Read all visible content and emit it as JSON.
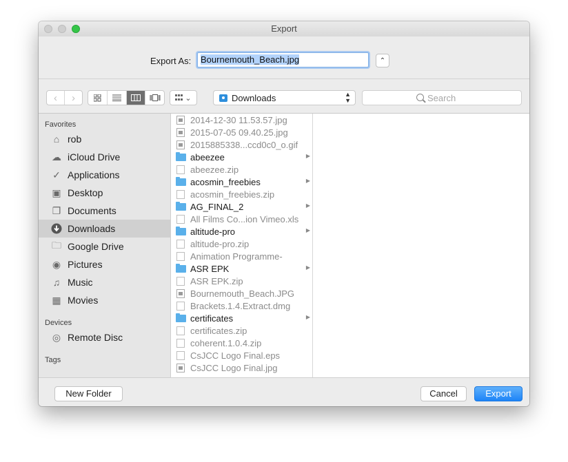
{
  "window": {
    "title": "Export"
  },
  "save": {
    "label": "Export As:",
    "filename": "Bournemouth_Beach.jpg"
  },
  "toolbar": {
    "location": "Downloads",
    "search_placeholder": "Search"
  },
  "sidebar": {
    "favorites_heading": "Favorites",
    "favorites": [
      {
        "label": "rob",
        "icon": "home-icon"
      },
      {
        "label": "iCloud Drive",
        "icon": "cloud-icon"
      },
      {
        "label": "Applications",
        "icon": "applications-icon"
      },
      {
        "label": "Desktop",
        "icon": "desktop-icon"
      },
      {
        "label": "Documents",
        "icon": "documents-icon"
      },
      {
        "label": "Downloads",
        "icon": "downloads-icon",
        "selected": true
      },
      {
        "label": "Google Drive",
        "icon": "folder-icon"
      },
      {
        "label": "Pictures",
        "icon": "camera-icon"
      },
      {
        "label": "Music",
        "icon": "music-icon"
      },
      {
        "label": "Movies",
        "icon": "film-icon"
      }
    ],
    "devices_heading": "Devices",
    "devices": [
      {
        "label": "Remote Disc",
        "icon": "disc-icon"
      }
    ],
    "tags_heading": "Tags"
  },
  "files": [
    {
      "name": "2014-12-30 11.53.57.jpg",
      "kind": "img"
    },
    {
      "name": "2015-07-05 09.40.25.jpg",
      "kind": "img"
    },
    {
      "name": "2015885338...ccd0c0_o.gif",
      "kind": "img"
    },
    {
      "name": "abeezee",
      "kind": "folder"
    },
    {
      "name": "abeezee.zip",
      "kind": "doc"
    },
    {
      "name": "acosmin_freebies",
      "kind": "folder"
    },
    {
      "name": "acosmin_freebies.zip",
      "kind": "doc"
    },
    {
      "name": "AG_FINAL_2",
      "kind": "folder"
    },
    {
      "name": "All Films Co...ion Vimeo.xls",
      "kind": "doc"
    },
    {
      "name": "altitude-pro",
      "kind": "folder"
    },
    {
      "name": "altitude-pro.zip",
      "kind": "doc"
    },
    {
      "name": "Animation Programme-",
      "kind": "doc"
    },
    {
      "name": "ASR EPK",
      "kind": "folder"
    },
    {
      "name": "ASR EPK.zip",
      "kind": "doc"
    },
    {
      "name": "Bournemouth_Beach.JPG",
      "kind": "img"
    },
    {
      "name": "Brackets.1.4.Extract.dmg",
      "kind": "doc"
    },
    {
      "name": "certificates",
      "kind": "folder"
    },
    {
      "name": "certificates.zip",
      "kind": "doc"
    },
    {
      "name": "coherent.1.0.4.zip",
      "kind": "doc"
    },
    {
      "name": "CsJCC Logo Final.eps",
      "kind": "doc"
    },
    {
      "name": "CsJCC Logo Final.jpg",
      "kind": "img"
    }
  ],
  "buttons": {
    "new_folder": "New Folder",
    "cancel": "Cancel",
    "export": "Export"
  }
}
